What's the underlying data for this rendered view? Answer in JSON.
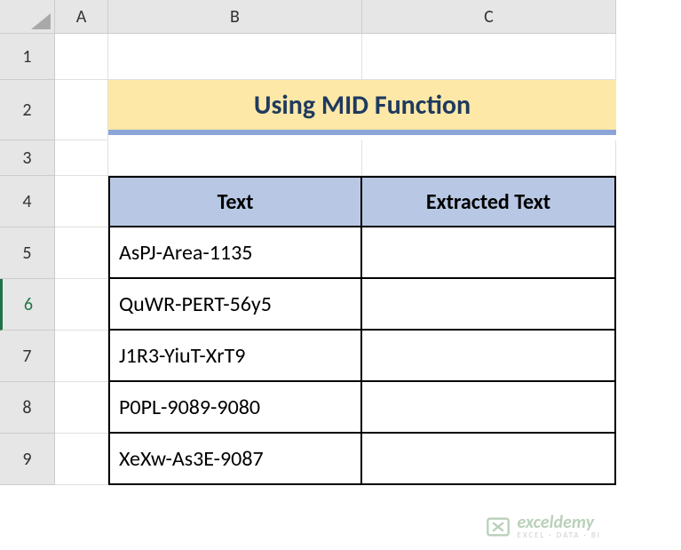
{
  "columns": [
    "A",
    "B",
    "C"
  ],
  "rows": [
    "1",
    "2",
    "3",
    "4",
    "5",
    "6",
    "7",
    "8",
    "9"
  ],
  "active_row_index": 5,
  "title": "Using MID Function",
  "table": {
    "headers": {
      "text": "Text",
      "extracted": "Extracted Text"
    },
    "data": [
      {
        "text": "AsPJ-Area-1135",
        "extracted": ""
      },
      {
        "text": "QuWR-PERT-56y5",
        "extracted": ""
      },
      {
        "text": "J1R3-YiuT-XrT9",
        "extracted": ""
      },
      {
        "text": "P0PL-9089-9080",
        "extracted": ""
      },
      {
        "text": "XeXw-As3E-9087",
        "extracted": ""
      }
    ]
  },
  "watermark": {
    "brand": "exceldemy",
    "sub": "EXCEL · DATA · BI"
  },
  "colors": {
    "title_bg": "#fde8a7",
    "title_underline": "#8ba6d6",
    "header_bg": "#b8c8e4",
    "grid_header_bg": "#e6e6e6"
  }
}
